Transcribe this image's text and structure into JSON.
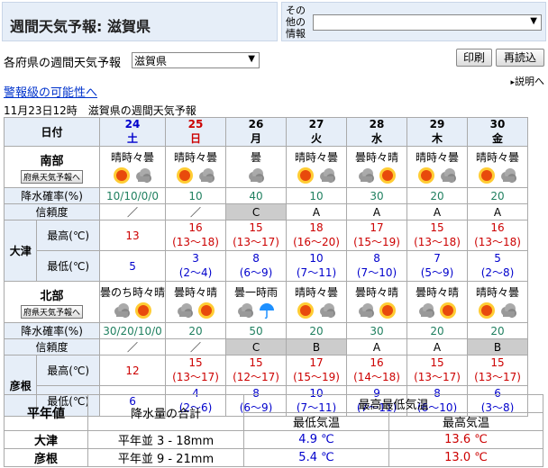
{
  "header": {
    "title": "週間天気予報: 滋賀県",
    "other_label_lines": [
      "その",
      "他の",
      "情報"
    ],
    "other_select_value": ""
  },
  "pref": {
    "label": "各府県の週間天気予報",
    "selected": "滋賀県",
    "print_button": "印刷",
    "reload_button": "再読込",
    "help_link": "説明へ"
  },
  "warning_link": "警報級の可能性へ",
  "issued": "11月23日12時　滋賀県の週間天気予報",
  "table": {
    "date_label": "日付",
    "pop_label": "降水確率(%)",
    "reliability_label": "信頼度",
    "max_label": "最高(℃)",
    "min_label": "最低(℃)",
    "pref_button": "府県天気予報へ",
    "days": [
      {
        "num": "24",
        "dow": "土",
        "type": "sat"
      },
      {
        "num": "25",
        "dow": "日",
        "type": "sun"
      },
      {
        "num": "26",
        "dow": "月",
        "type": ""
      },
      {
        "num": "27",
        "dow": "火",
        "type": ""
      },
      {
        "num": "28",
        "dow": "水",
        "type": ""
      },
      {
        "num": "29",
        "dow": "木",
        "type": ""
      },
      {
        "num": "30",
        "dow": "金",
        "type": ""
      }
    ],
    "regions": [
      {
        "area": "南部",
        "city": "大津",
        "weather": [
          {
            "text": "晴時々曇",
            "icons": [
              "sun-icon",
              "cloud-icon"
            ]
          },
          {
            "text": "晴時々曇",
            "icons": [
              "sun-icon",
              "cloud-icon"
            ]
          },
          {
            "text": "曇",
            "icons": [
              "cloud-icon"
            ]
          },
          {
            "text": "晴時々曇",
            "icons": [
              "sun-icon",
              "cloud-icon"
            ]
          },
          {
            "text": "曇時々晴",
            "icons": [
              "cloud-icon",
              "sun-icon"
            ]
          },
          {
            "text": "晴時々曇",
            "icons": [
              "sun-icon",
              "cloud-icon"
            ]
          },
          {
            "text": "晴時々曇",
            "icons": [
              "sun-icon",
              "cloud-icon"
            ]
          }
        ],
        "pop": [
          "10/10/0/0",
          "10",
          "40",
          "10",
          "30",
          "20",
          "20"
        ],
        "reliability": [
          "／",
          "／",
          "C",
          "A",
          "A",
          "A",
          "A"
        ],
        "max": [
          {
            "v": "13",
            "r": ""
          },
          {
            "v": "16",
            "r": "(13～18)"
          },
          {
            "v": "15",
            "r": "(13～17)"
          },
          {
            "v": "18",
            "r": "(16～20)"
          },
          {
            "v": "17",
            "r": "(15～19)"
          },
          {
            "v": "15",
            "r": "(13～18)"
          },
          {
            "v": "16",
            "r": "(13～18)"
          }
        ],
        "min": [
          {
            "v": "5",
            "r": ""
          },
          {
            "v": "3",
            "r": "(2～4)"
          },
          {
            "v": "8",
            "r": "(6～9)"
          },
          {
            "v": "10",
            "r": "(7～11)"
          },
          {
            "v": "8",
            "r": "(7～10)"
          },
          {
            "v": "7",
            "r": "(5～9)"
          },
          {
            "v": "5",
            "r": "(2～8)"
          }
        ]
      },
      {
        "area": "北部",
        "city": "彦根",
        "weather": [
          {
            "text": "曇のち時々晴",
            "icons": [
              "cloud-icon",
              "sun-icon"
            ]
          },
          {
            "text": "曇時々晴",
            "icons": [
              "cloud-icon",
              "sun-icon"
            ]
          },
          {
            "text": "曇一時雨",
            "icons": [
              "cloud-icon",
              "umbrella-icon"
            ]
          },
          {
            "text": "晴時々曇",
            "icons": [
              "sun-icon",
              "cloud-icon"
            ]
          },
          {
            "text": "曇時々晴",
            "icons": [
              "cloud-icon",
              "sun-icon"
            ]
          },
          {
            "text": "曇時々晴",
            "icons": [
              "cloud-icon",
              "sun-icon"
            ]
          },
          {
            "text": "晴時々曇",
            "icons": [
              "sun-icon",
              "cloud-icon"
            ]
          }
        ],
        "pop": [
          "30/20/10/0",
          "20",
          "50",
          "20",
          "30",
          "20",
          "20"
        ],
        "reliability": [
          "／",
          "／",
          "C",
          "B",
          "A",
          "A",
          "B"
        ],
        "max": [
          {
            "v": "12",
            "r": ""
          },
          {
            "v": "15",
            "r": "(13～17)"
          },
          {
            "v": "15",
            "r": "(12～17)"
          },
          {
            "v": "17",
            "r": "(15～19)"
          },
          {
            "v": "16",
            "r": "(14～18)"
          },
          {
            "v": "15",
            "r": "(13～17)"
          },
          {
            "v": "15",
            "r": "(13～17)"
          }
        ],
        "min": [
          {
            "v": "6",
            "r": ""
          },
          {
            "v": "4",
            "r": "(2～6)"
          },
          {
            "v": "8",
            "r": "(6～9)"
          },
          {
            "v": "10",
            "r": "(7～11)"
          },
          {
            "v": "9",
            "r": "(7～11)"
          },
          {
            "v": "8",
            "r": "(6～10)"
          },
          {
            "v": "6",
            "r": "(3～8)"
          }
        ]
      }
    ]
  },
  "averages": {
    "label": "平年値",
    "precip_label": "降水量の合計",
    "temp_header": "最高最低気温",
    "min_header": "最低気温",
    "max_header": "最高気温",
    "rows": [
      {
        "city": "大津",
        "precip": "平年並 3 - 18mm",
        "min": "4.9 ℃",
        "max": "13.6 ℃"
      },
      {
        "city": "彦根",
        "precip": "平年並 9 - 21mm",
        "min": "5.4 ℃",
        "max": "13.0 ℃"
      }
    ]
  },
  "colors": {
    "sunday": "#cc0000",
    "saturday": "#0000cc",
    "max_temp": "#cc0000",
    "min_temp": "#0000cc",
    "pop": "#208060"
  }
}
